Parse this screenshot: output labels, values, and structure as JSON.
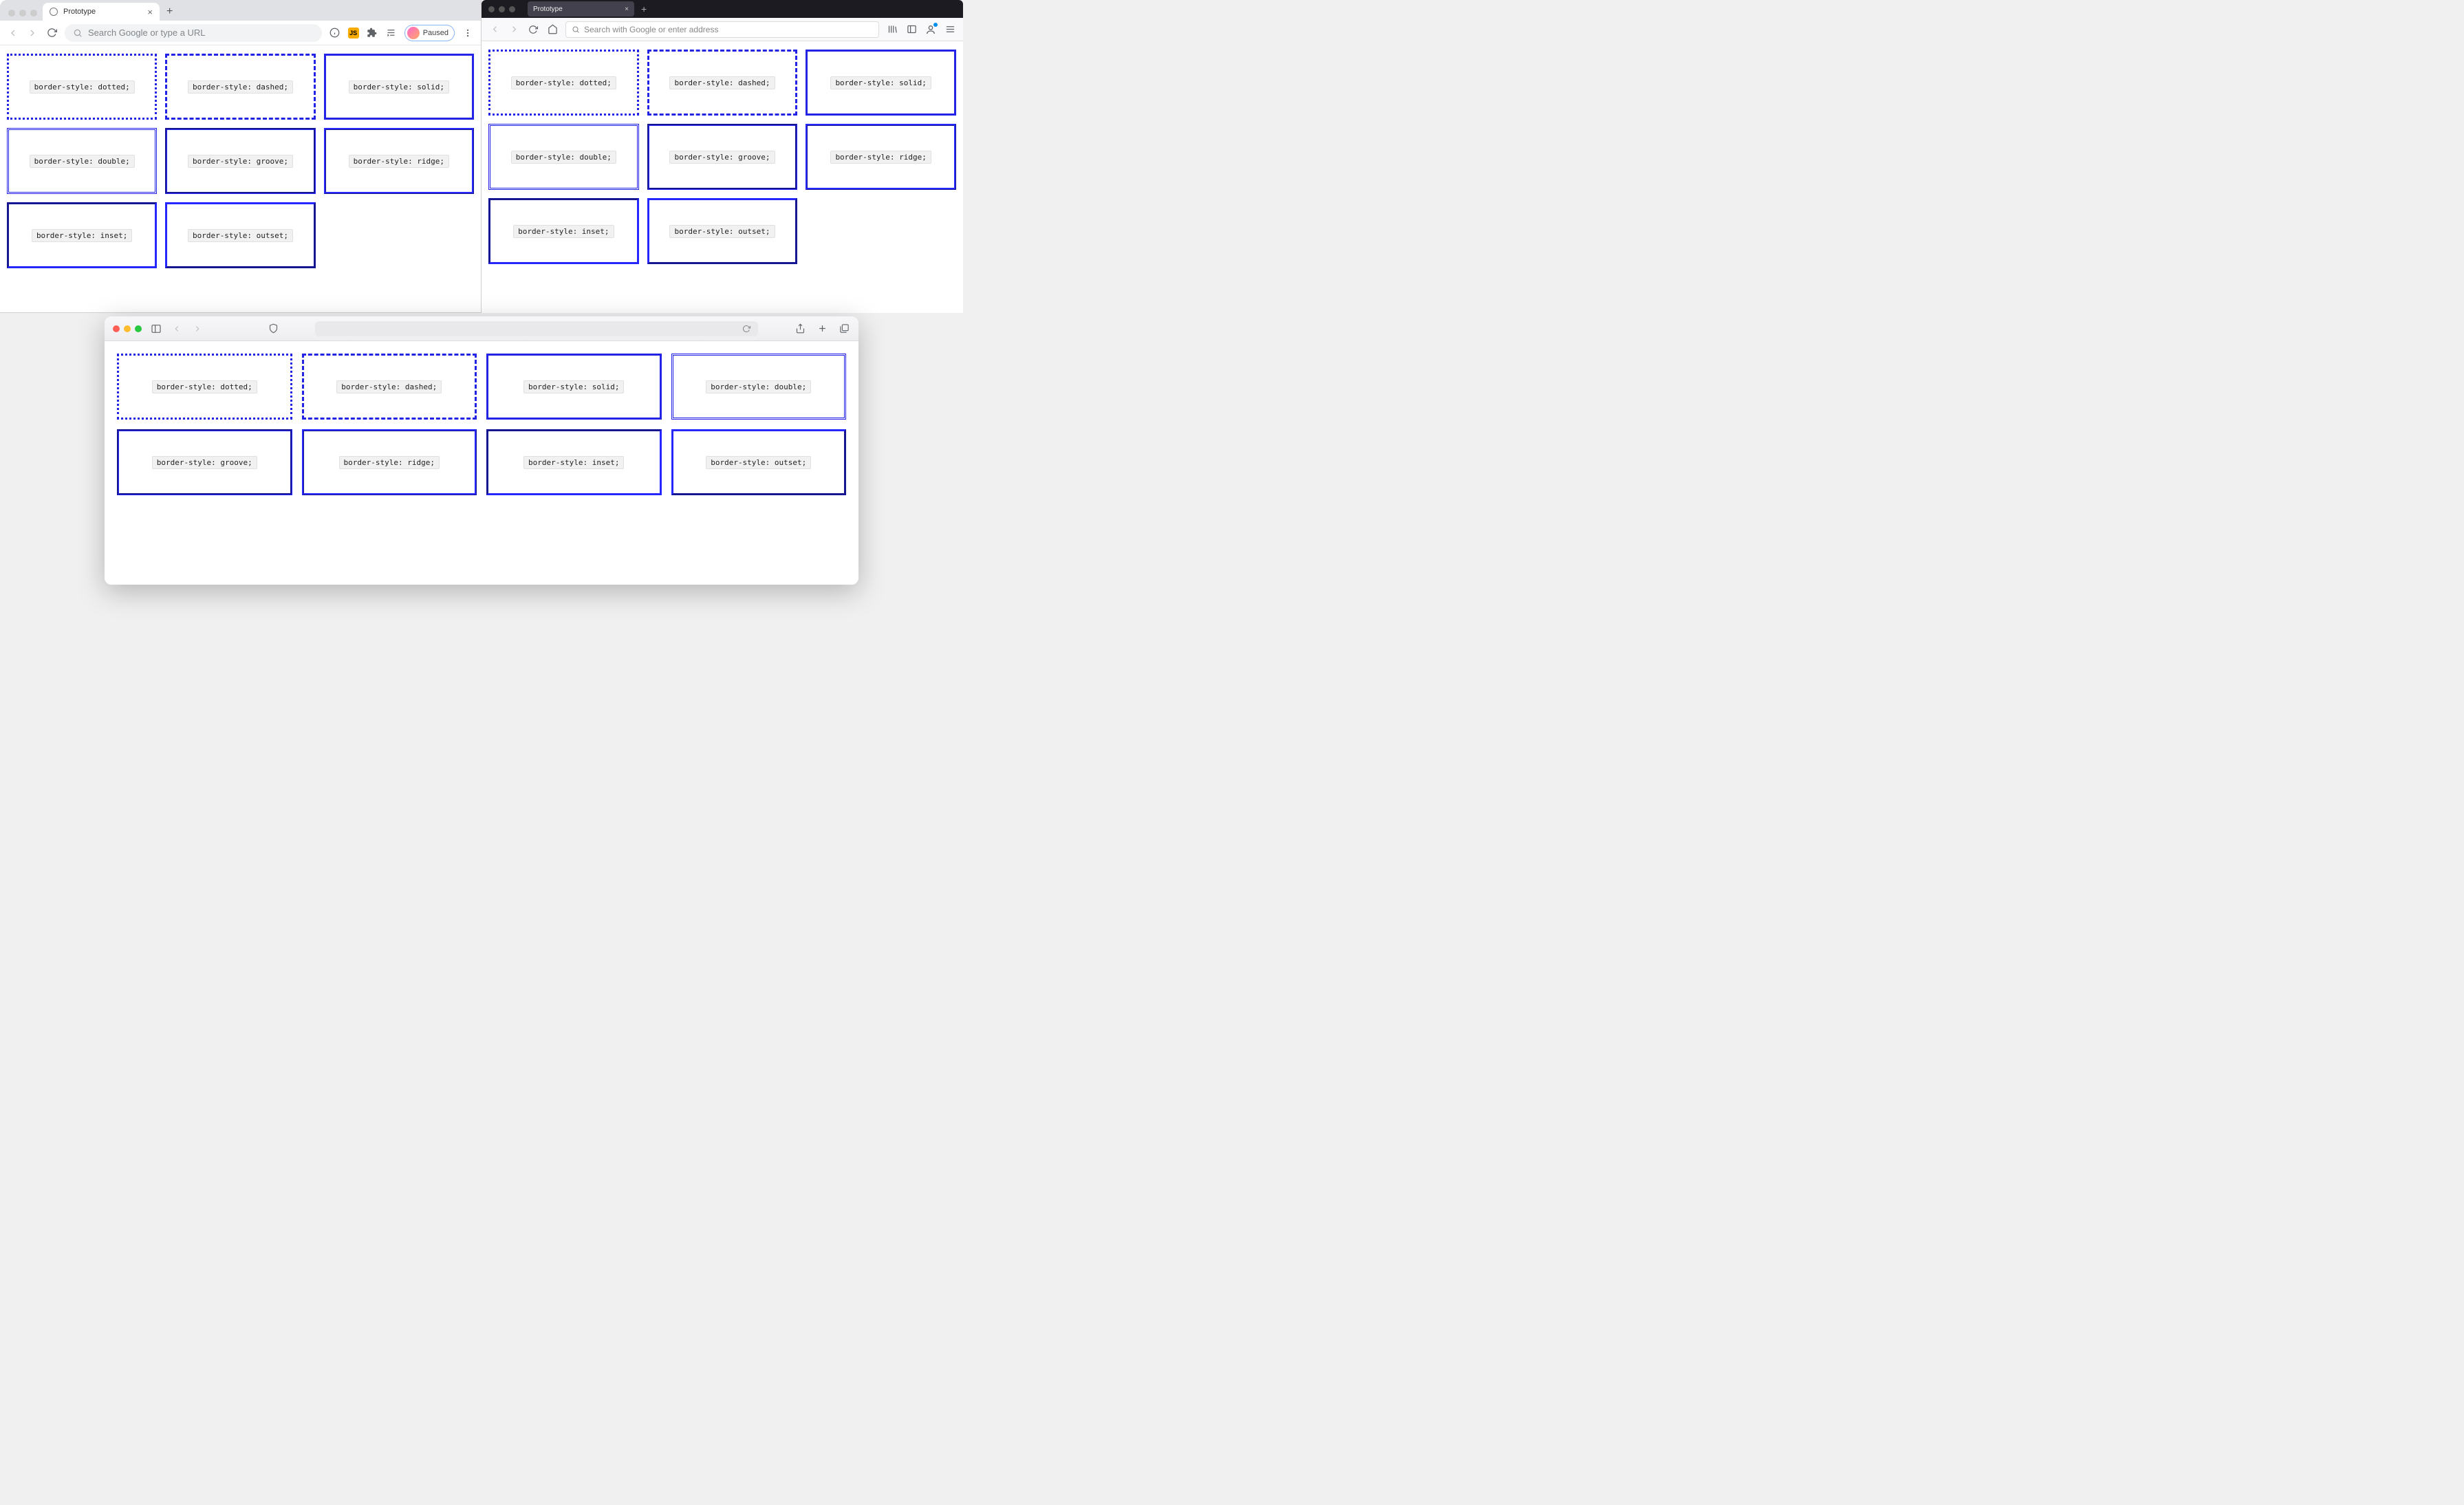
{
  "chrome": {
    "tab_title": "Prototype",
    "omnibox_placeholder": "Search Google or type a URL",
    "profile_label": "Paused",
    "boxes": [
      {
        "label": "border-style: dotted;",
        "style": "dotted"
      },
      {
        "label": "border-style: dashed;",
        "style": "dashed"
      },
      {
        "label": "border-style: solid;",
        "style": "solid"
      },
      {
        "label": "border-style: double;",
        "style": "double"
      },
      {
        "label": "border-style: groove;",
        "style": "groove"
      },
      {
        "label": "border-style: ridge;",
        "style": "ridge"
      },
      {
        "label": "border-style: inset;",
        "style": "inset"
      },
      {
        "label": "border-style: outset;",
        "style": "outset"
      }
    ]
  },
  "firefox": {
    "tab_title": "Prototype",
    "omnibox_placeholder": "Search with Google or enter address",
    "boxes": [
      {
        "label": "border-style: dotted;",
        "style": "dotted"
      },
      {
        "label": "border-style: dashed;",
        "style": "dashed"
      },
      {
        "label": "border-style: solid;",
        "style": "solid"
      },
      {
        "label": "border-style: double;",
        "style": "double"
      },
      {
        "label": "border-style: groove;",
        "style": "groove"
      },
      {
        "label": "border-style: ridge;",
        "style": "ridge"
      },
      {
        "label": "border-style: inset;",
        "style": "inset"
      },
      {
        "label": "border-style: outset;",
        "style": "outset"
      }
    ]
  },
  "safari": {
    "boxes": [
      {
        "label": "border-style: dotted;",
        "style": "dotted"
      },
      {
        "label": "border-style: dashed;",
        "style": "dashed"
      },
      {
        "label": "border-style: solid;",
        "style": "solid"
      },
      {
        "label": "border-style: double;",
        "style": "double"
      },
      {
        "label": "border-style: groove;",
        "style": "groove"
      },
      {
        "label": "border-style: ridge;",
        "style": "ridge"
      },
      {
        "label": "border-style: inset;",
        "style": "inset"
      },
      {
        "label": "border-style: outset;",
        "style": "outset"
      }
    ]
  },
  "border_color": "#2323e6"
}
